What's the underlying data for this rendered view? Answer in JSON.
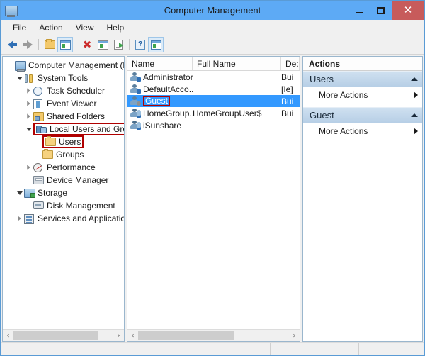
{
  "window": {
    "title": "Computer Management",
    "icon": "computer-management-icon",
    "accent_titlebar": "#5daaf5",
    "accent_close": "#c75b5b",
    "controls": {
      "minimize": "–",
      "maximize": "□",
      "close": "✕"
    }
  },
  "menubar": {
    "items": [
      "File",
      "Action",
      "View",
      "Help"
    ]
  },
  "toolbar": {
    "buttons": [
      {
        "name": "back-button",
        "icon": "arrow-left-icon",
        "enabled": true
      },
      {
        "name": "forward-button",
        "icon": "arrow-right-icon",
        "enabled": false
      },
      {
        "name": "up-one-level-button",
        "icon": "folder-up-icon",
        "enabled": true
      },
      {
        "name": "show-hide-console-tree-button",
        "icon": "console-tree-icon",
        "pressed": true
      },
      {
        "name": "delete-button",
        "icon": "delete-x-icon",
        "enabled": true
      },
      {
        "name": "properties-button",
        "icon": "properties-icon",
        "enabled": true
      },
      {
        "name": "export-list-button",
        "icon": "export-list-icon",
        "enabled": true
      },
      {
        "name": "help-button",
        "icon": "help-question-icon",
        "enabled": true
      },
      {
        "name": "show-hide-action-pane-button",
        "icon": "action-pane-icon",
        "pressed": true
      }
    ]
  },
  "tree": {
    "nodes": [
      {
        "label": "Computer Management (Local",
        "indent": 0,
        "twist": "none",
        "icon": "computer-icon",
        "highlight": false
      },
      {
        "label": "System Tools",
        "indent": 1,
        "twist": "expanded",
        "icon": "system-tools-icon",
        "highlight": false
      },
      {
        "label": "Task Scheduler",
        "indent": 2,
        "twist": "collapsed",
        "icon": "task-scheduler-icon",
        "highlight": false
      },
      {
        "label": "Event Viewer",
        "indent": 2,
        "twist": "collapsed",
        "icon": "event-viewer-icon",
        "highlight": false
      },
      {
        "label": "Shared Folders",
        "indent": 2,
        "twist": "collapsed",
        "icon": "shared-folders-icon",
        "highlight": false
      },
      {
        "label": "Local Users and Groups",
        "indent": 2,
        "twist": "expanded",
        "icon": "local-users-groups-icon",
        "highlight": true
      },
      {
        "label": "Users",
        "indent": 3,
        "twist": "none",
        "icon": "folder-icon",
        "highlight": true
      },
      {
        "label": "Groups",
        "indent": 3,
        "twist": "none",
        "icon": "folder-icon",
        "highlight": false
      },
      {
        "label": "Performance",
        "indent": 2,
        "twist": "collapsed",
        "icon": "performance-icon",
        "highlight": false
      },
      {
        "label": "Device Manager",
        "indent": 2,
        "twist": "none",
        "icon": "device-manager-icon",
        "highlight": false
      },
      {
        "label": "Storage",
        "indent": 1,
        "twist": "expanded",
        "icon": "storage-icon",
        "highlight": false
      },
      {
        "label": "Disk Management",
        "indent": 2,
        "twist": "none",
        "icon": "disk-management-icon",
        "highlight": false
      },
      {
        "label": "Services and Applications",
        "indent": 1,
        "twist": "collapsed",
        "icon": "services-apps-icon",
        "highlight": false
      }
    ],
    "scrollbar": {
      "left_arrow": "‹",
      "right_arrow": "›"
    }
  },
  "list": {
    "columns": [
      "Name",
      "Full Name",
      "De:"
    ],
    "rows": [
      {
        "name": "Administrator",
        "full_name": "",
        "description": "Bui",
        "icon": "user-icon",
        "selected": false,
        "highlight": false
      },
      {
        "name": "DefaultAcco...",
        "full_name": "",
        "description": "[Ie]",
        "icon": "user-icon",
        "selected": false,
        "highlight": false
      },
      {
        "name": "Guest",
        "full_name": "",
        "description": "Bui",
        "icon": "guest-user-icon",
        "selected": true,
        "highlight": true
      },
      {
        "name": "HomeGroup...",
        "full_name": "HomeGroupUser$",
        "description": "Bui",
        "icon": "user-icon",
        "selected": false,
        "highlight": false
      },
      {
        "name": "iSunshare",
        "full_name": "",
        "description": "",
        "icon": "user-icon",
        "selected": false,
        "highlight": false
      }
    ],
    "selection_color": "#3399ff",
    "scrollbar": {
      "left_arrow": "‹",
      "right_arrow": "›"
    }
  },
  "actions": {
    "header": "Actions",
    "sections": [
      {
        "title": "Users",
        "items": [
          {
            "label": "More Actions",
            "submenu": true
          }
        ]
      },
      {
        "title": "Guest",
        "items": [
          {
            "label": "More Actions",
            "submenu": true
          }
        ]
      }
    ]
  },
  "annotation": {
    "color": "#b00000",
    "targets": [
      "Local Users and Groups",
      "Users",
      "Guest"
    ]
  },
  "statusbar": {
    "segments": [
      "",
      "",
      ""
    ]
  }
}
